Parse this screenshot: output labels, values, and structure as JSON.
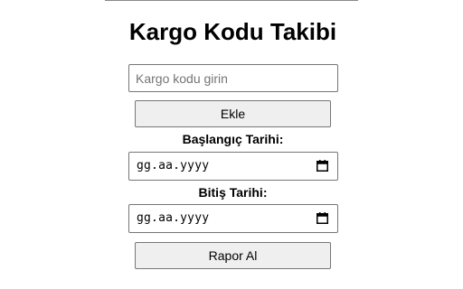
{
  "page": {
    "title": "Kargo Kodu Takibi"
  },
  "cargo_code": {
    "placeholder": "Kargo kodu girin",
    "value": ""
  },
  "add_button": {
    "label": "Ekle"
  },
  "start_date": {
    "label": "Başlangıç Tarihi:",
    "display": "gg.aa.yyyy",
    "icon": "calendar-icon"
  },
  "end_date": {
    "label": "Bitiş Tarihi:",
    "display": "gg.aa.yyyy",
    "icon": "calendar-icon"
  },
  "report_button": {
    "label": "Rapor Al"
  }
}
